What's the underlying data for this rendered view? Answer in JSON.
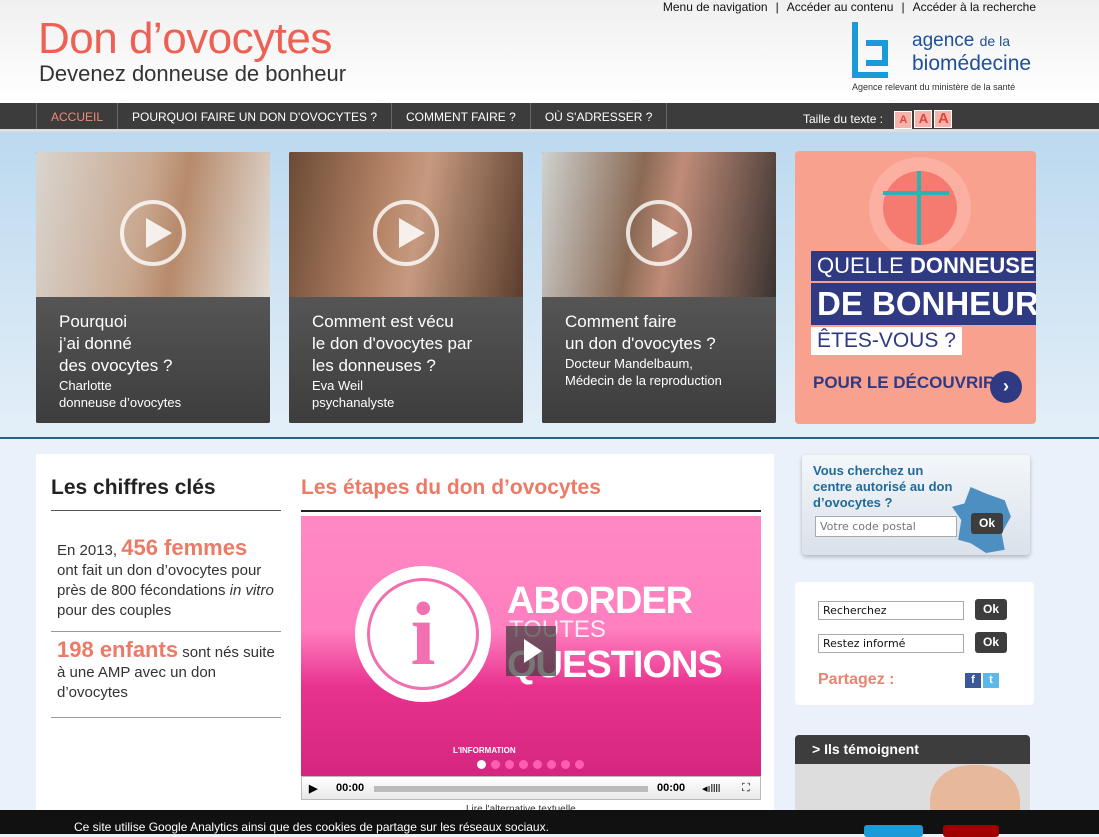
{
  "top_links": [
    "Menu de navigation",
    "Accéder au contenu",
    "Accéder à la recherche"
  ],
  "header": {
    "title": "Don d’ovocytes",
    "subtitle": "Devenez donneuse de bonheur"
  },
  "logo": {
    "line1": "agence",
    "line1b": "de la",
    "line2": "biomédecine",
    "tagline": "Agence relevant du ministère de la santé"
  },
  "nav": {
    "items": [
      "Accueil",
      "Pourquoi faire un don d'ovocytes ?",
      "Comment faire ?",
      "Où s'adresser ?"
    ],
    "text_size_label": "Taille du texte :",
    "text_size_buttons": [
      "A",
      "A",
      "A"
    ]
  },
  "videos": [
    {
      "question": [
        "Pourquoi",
        "j’ai donné",
        "des ovocytes ?"
      ],
      "sub": [
        "Charlotte",
        "donneuse d’ovocytes"
      ]
    },
    {
      "question": [
        "Comment est vécu",
        "le don d'ovocytes par",
        "les donneuses ?"
      ],
      "sub": [
        "Eva Weil",
        "psychanalyste"
      ]
    },
    {
      "question": [
        "Comment faire",
        "un don d'ovocytes ?"
      ],
      "sub": [
        "Docteur Mandelbaum,",
        "Médecin de la reproduction"
      ]
    }
  ],
  "promo": {
    "line1a": "QUELLE ",
    "line1b": "DONNEUSE",
    "line2": "DE BONHEUR",
    "line3": "ÊTES-VOUS ?",
    "cta": "POUR LE DÉCOUVRIR",
    "brand_color": "#2f3a83",
    "bg_color": "#f9a18f"
  },
  "chiffres": {
    "title": "Les chiffres clés",
    "s1_pre": "En 2013, ",
    "s1_big": "456 femmes",
    "s1_rest": "ont fait un don d’ovocytes pour près de 800 fécondations ",
    "s1_em": "in vitro",
    "s1_end": " pour des couples",
    "s2_big": "198 enfants",
    "s2_rest": " sont nés suite à une AMP avec un don d’ovocytes"
  },
  "etapes": {
    "title": "Les étapes du don d’ovocytes",
    "slide_w1": "ABORDER",
    "slide_w2": "TOUTES",
    "slide_w3": "QUESTIONS",
    "slide_caption": "L'INFORMATION",
    "slide_count": 8,
    "current_slide": 1,
    "time_current": "00:00",
    "time_total": "00:00",
    "alt_link": "Lire l'alternative textuelle"
  },
  "locator": {
    "question": "Vous cherchez un centre autorisé au don d’ovocytes ?",
    "placeholder": "Votre code postal",
    "ok": "Ok"
  },
  "search": {
    "search_value": "Recherchez",
    "newsletter_value": "Restez informé",
    "ok": "Ok",
    "share_label": "Partagez :"
  },
  "temoignent": {
    "title": "> Ils témoignent"
  },
  "cookie": {
    "text": "Ce site utilise Google Analytics ainsi que des cookies de partage sur les réseaux sociaux."
  },
  "colors": {
    "accent": "#ec6153",
    "nav": "#3c3c3c",
    "logo_blue": "#1a9ad7"
  }
}
